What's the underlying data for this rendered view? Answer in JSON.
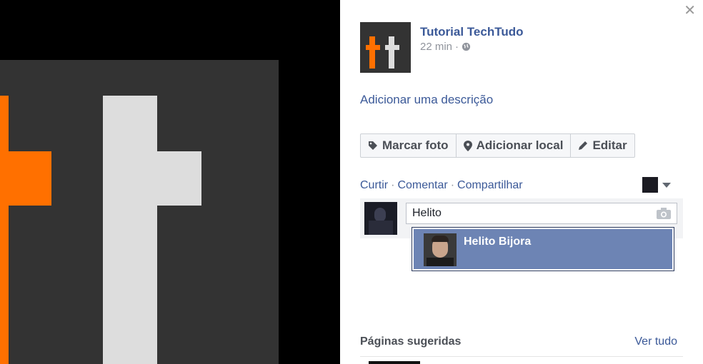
{
  "post": {
    "author": "Tutorial TechTudo",
    "time": "22 min",
    "time_separator": "·",
    "add_description": "Adicionar uma descrição"
  },
  "toolbar": {
    "tag_label": "Marcar foto",
    "location_label": "Adicionar local",
    "edit_label": "Editar"
  },
  "actions": {
    "like": "Curtir",
    "comment": "Comentar",
    "share": "Compartilhar",
    "separator": "·"
  },
  "comment": {
    "value": "Helito"
  },
  "mention_suggestion": {
    "name": "Helito Bijora"
  },
  "suggested_pages": {
    "title": "Páginas sugeridas",
    "see_all": "Ver tudo"
  },
  "icons": {
    "close": "close-icon",
    "globe": "globe-icon",
    "tag": "tag-icon",
    "pin": "map-pin-icon",
    "pencil": "pencil-icon",
    "camera": "camera-icon",
    "caret": "chevron-down-icon"
  },
  "colors": {
    "brand_blue": "#3b5998",
    "logo_orange": "#ff7000",
    "logo_bg": "#333333",
    "suggestion_highlight": "#6d84b4"
  }
}
